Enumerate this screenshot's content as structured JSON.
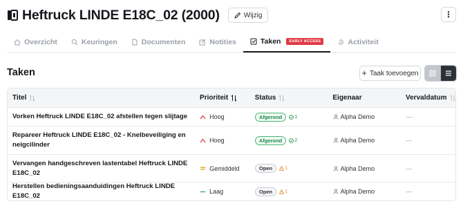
{
  "header": {
    "title": "Heftruck LINDE E18C_02 (2000)",
    "edit_label": "Wijzig",
    "more_label": "⋮"
  },
  "tabs": [
    {
      "label": "Overzicht",
      "icon": "home-icon",
      "active": false
    },
    {
      "label": "Keuringen",
      "icon": "search-icon",
      "active": false
    },
    {
      "label": "Documenten",
      "icon": "document-icon",
      "active": false
    },
    {
      "label": "Notities",
      "icon": "edit-icon",
      "active": false
    },
    {
      "label": "Taken",
      "icon": "checkbox-icon",
      "active": true,
      "badge": "EARLY ACCESS"
    },
    {
      "label": "Activiteit",
      "icon": "history-icon",
      "active": false
    }
  ],
  "section": {
    "title": "Taken",
    "add_label": "Taak toevoegen"
  },
  "table": {
    "columns": [
      "Titel",
      "Prioriteit",
      "Status",
      "Eigenaar",
      "Vervaldatum"
    ],
    "rows": [
      {
        "title": "Vorken Heftruck LINDE E18C_02 afstellen tegen slijtage",
        "priority": "Hoog",
        "priority_level": "high",
        "status": "Afgerond",
        "status_type": "done",
        "count": "1",
        "owner": "Alpha Demo",
        "due": "—"
      },
      {
        "title": "Repareer Heftruck LINDE E18C_02 - Knelbeveiliging en neigcilinder",
        "priority": "Hoog",
        "priority_level": "high",
        "status": "Afgerond",
        "status_type": "done",
        "count": "2",
        "owner": "Alpha Demo",
        "due": "—"
      },
      {
        "title": "Vervangen handgeschreven lastentabel Heftruck LINDE E18C_02",
        "priority": "Gemiddeld",
        "priority_level": "medium",
        "status": "Open",
        "status_type": "open",
        "count": "1",
        "owner": "Alpha Demo",
        "due": "—"
      },
      {
        "title": "Herstellen bedieningsaanduidingen Heftruck LINDE E18C_02",
        "priority": "Laag",
        "priority_level": "low",
        "status": "Open",
        "status_type": "open",
        "count": "1",
        "owner": "Alpha Demo",
        "due": "—"
      }
    ]
  },
  "colors": {
    "priority_high": "#e03a45",
    "priority_medium": "#e6a317",
    "priority_low": "#2fa866",
    "badge_early_access": "#e03a45",
    "status_done": "#1f8a4c",
    "warning": "#d98a1e"
  }
}
